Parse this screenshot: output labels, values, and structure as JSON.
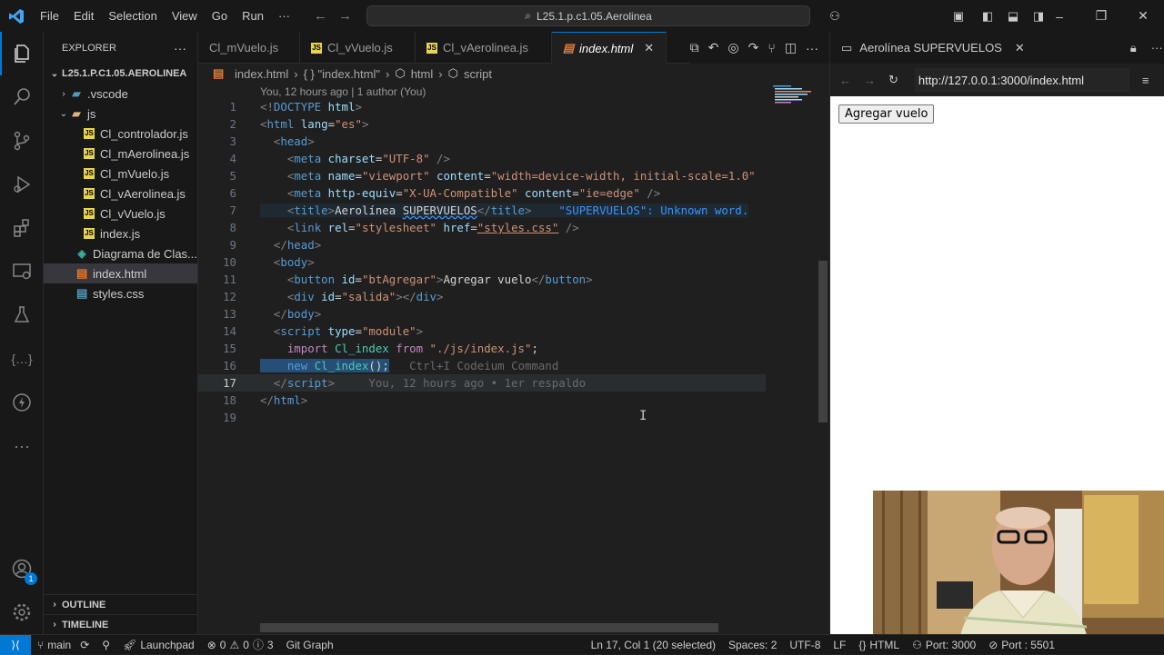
{
  "titlebar": {
    "menu": [
      "File",
      "Edit",
      "Selection",
      "View",
      "Go",
      "Run",
      "···"
    ],
    "command_center": "L25.1.p.c1.05.Aerolinea",
    "window_controls": [
      "–",
      "❐",
      "✕"
    ]
  },
  "explorer": {
    "title": "EXPLORER",
    "root": "L25.1.P.C1.05.AEROLINEA",
    "items": [
      {
        "label": ".vscode",
        "kind": "folder-collapsed",
        "icon": "vscode-folder-icon"
      },
      {
        "label": "js",
        "kind": "folder-open",
        "icon": "folder-icon"
      },
      {
        "label": "Cl_controlador.js",
        "kind": "js"
      },
      {
        "label": "Cl_mAerolinea.js",
        "kind": "js"
      },
      {
        "label": "Cl_mVuelo.js",
        "kind": "js"
      },
      {
        "label": "Cl_vAerolinea.js",
        "kind": "js"
      },
      {
        "label": "Cl_vVuelo.js",
        "kind": "js"
      },
      {
        "label": "index.js",
        "kind": "js"
      },
      {
        "label": "Diagrama de Clas...",
        "kind": "diagram"
      },
      {
        "label": "index.html",
        "kind": "html",
        "selected": true
      },
      {
        "label": "styles.css",
        "kind": "css"
      }
    ],
    "outline": "OUTLINE",
    "timeline": "TIMELINE",
    "accounts_badge": "1"
  },
  "tabs": [
    {
      "label": "Cl_mVuelo.js",
      "kind": "js"
    },
    {
      "label": "Cl_vVuelo.js",
      "kind": "js"
    },
    {
      "label": "Cl_vAerolinea.js",
      "kind": "js"
    },
    {
      "label": "index.html",
      "kind": "html",
      "active": true
    }
  ],
  "breadcrumbs": [
    "index.html",
    "{ } \"index.html\"",
    "html",
    "script"
  ],
  "editor": {
    "codelens": "You, 12 hours ago | 1 author (You)",
    "current_line": 17,
    "inline_hint": "Ctrl+I Codeium Command",
    "blame": "You, 12 hours ago • 1er respaldo",
    "diagnostic": "\"SUPERVUELOS\": Unknown word."
  },
  "browser": {
    "tab_title": "Aerolínea SUPERVUELOS",
    "url": "http://127.0.0.1:3000/index.html",
    "button_label": "Agregar vuelo"
  },
  "statusbar": {
    "branch": "main",
    "launchpad": "Launchpad",
    "problems": "0",
    "warnings": "0",
    "info": "3",
    "git_graph": "Git Graph",
    "position": "Ln 17, Col 1 (20 selected)",
    "spaces": "Spaces: 2",
    "encoding": "UTF-8",
    "eol": "LF",
    "language": "HTML",
    "port": "Port: 3000",
    "port2": "Port : 5501"
  },
  "colors": {
    "accent": "#0078d4",
    "background": "#1f1f1f",
    "sidebar": "#181818"
  }
}
